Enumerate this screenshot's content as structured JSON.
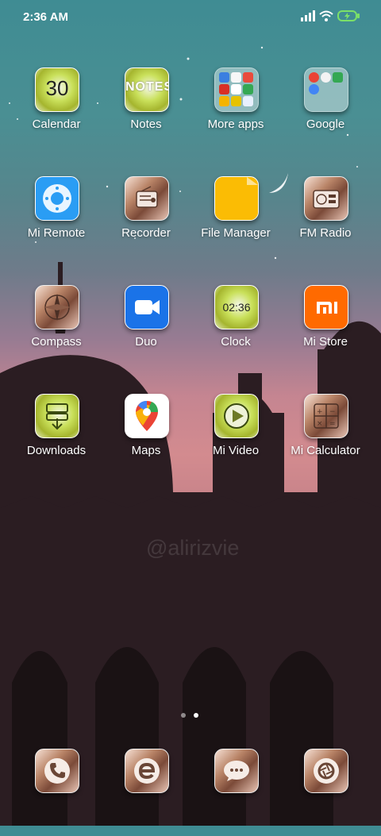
{
  "status_bar": {
    "time": "2:36 AM"
  },
  "rows": [
    [
      {
        "label": "Calendar",
        "icon": "calendar-icon",
        "text": "30"
      },
      {
        "label": "Notes",
        "icon": "notes-icon",
        "text": "NOTES"
      },
      {
        "label": "More apps",
        "icon": "folder-icon"
      },
      {
        "label": "Google",
        "icon": "folder-icon"
      }
    ],
    [
      {
        "label": "Mi Remote",
        "icon": "remote-icon"
      },
      {
        "label": "Recorder",
        "icon": "radio-recorder-icon"
      },
      {
        "label": "File Manager",
        "icon": "folder-file-icon"
      },
      {
        "label": "FM Radio",
        "icon": "radio-icon"
      }
    ],
    [
      {
        "label": "Compass",
        "icon": "compass-icon"
      },
      {
        "label": "Duo",
        "icon": "video-camera-icon"
      },
      {
        "label": "Clock",
        "icon": "clock-icon",
        "text": "02:36"
      },
      {
        "label": "Mi Store",
        "icon": "mi-logo-icon"
      }
    ],
    [
      {
        "label": "Downloads",
        "icon": "download-icon"
      },
      {
        "label": "Maps",
        "icon": "map-pin-icon"
      },
      {
        "label": "Mi Video",
        "icon": "play-icon"
      },
      {
        "label": "Mi Calculator",
        "icon": "calculator-icon"
      }
    ]
  ],
  "dock": [
    "phone-icon",
    "browser-icon",
    "messages-icon",
    "camera-icon"
  ],
  "watermark": "@alirizvie",
  "page_indicator": {
    "pages": 2,
    "current": 2
  }
}
